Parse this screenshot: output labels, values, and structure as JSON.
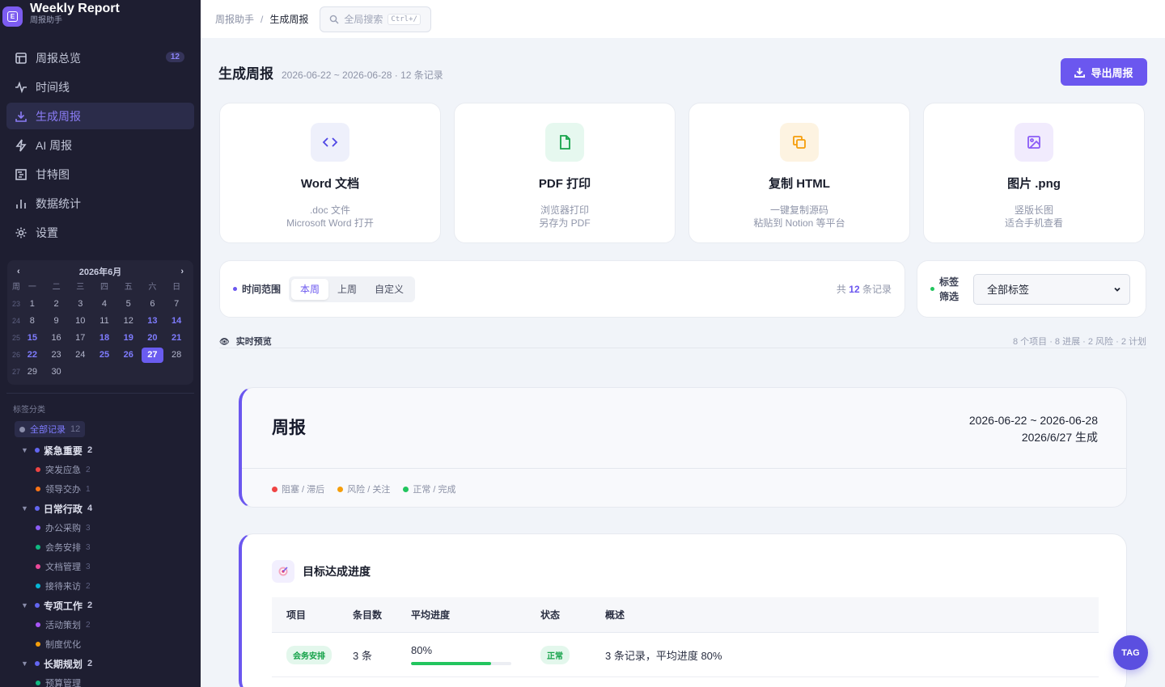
{
  "brand": {
    "title": "Weekly Report",
    "subtitle": "周报助手",
    "logo_letter": "E"
  },
  "nav": {
    "items": [
      {
        "label": "周报总览",
        "icon": "layout-icon",
        "badge": "12"
      },
      {
        "label": "时间线",
        "icon": "activity-icon"
      },
      {
        "label": "生成周报",
        "icon": "download-icon",
        "active": true
      },
      {
        "label": "AI 周报",
        "icon": "zap-icon"
      },
      {
        "label": "甘特图",
        "icon": "gantt-icon"
      },
      {
        "label": "数据统计",
        "icon": "bar-chart-icon"
      },
      {
        "label": "设置",
        "icon": "gear-icon"
      }
    ]
  },
  "calendar": {
    "month": "2026年6月",
    "prev": "‹",
    "next": "›",
    "weekdays": [
      "周",
      "一",
      "二",
      "三",
      "四",
      "五",
      "六",
      "日"
    ],
    "weeks": [
      {
        "wk": "23",
        "days": [
          "1",
          "2",
          "3",
          "4",
          "5",
          "6",
          "7"
        ]
      },
      {
        "wk": "24",
        "days": [
          "8",
          "9",
          "10",
          "11",
          "12",
          "13",
          "14"
        ]
      },
      {
        "wk": "25",
        "days": [
          "15",
          "16",
          "17",
          "18",
          "19",
          "20",
          "21"
        ]
      },
      {
        "wk": "26",
        "days": [
          "22",
          "23",
          "24",
          "25",
          "26",
          "27",
          "28"
        ]
      },
      {
        "wk": "27",
        "days": [
          "29",
          "30",
          "",
          "",
          "",
          "",
          ""
        ]
      }
    ],
    "highlighted": [
      "13",
      "14",
      "15",
      "18",
      "19",
      "20",
      "21",
      "22",
      "25",
      "26"
    ],
    "today": "27"
  },
  "tags": {
    "heading": "标签分类",
    "all": {
      "label": "全部记录",
      "count": "12"
    },
    "groups": [
      {
        "label": "紧急重要",
        "count": "2",
        "color": "#6366f1",
        "children": [
          {
            "label": "突发应急",
            "count": "2",
            "color": "#ef4444"
          },
          {
            "label": "领导交办",
            "count": "1",
            "color": "#f97316"
          }
        ]
      },
      {
        "label": "日常行政",
        "count": "4",
        "color": "#6366f1",
        "children": [
          {
            "label": "办公采购",
            "count": "3",
            "color": "#8b5cf6"
          },
          {
            "label": "会务安排",
            "count": "3",
            "color": "#10b981"
          },
          {
            "label": "文档管理",
            "count": "3",
            "color": "#ec4899"
          },
          {
            "label": "接待来访",
            "count": "2",
            "color": "#06b6d4"
          }
        ]
      },
      {
        "label": "专项工作",
        "count": "2",
        "color": "#6366f1",
        "children": [
          {
            "label": "活动策划",
            "count": "2",
            "color": "#a855f7"
          },
          {
            "label": "制度优化",
            "count": "",
            "color": "#f59e0b"
          }
        ]
      },
      {
        "label": "长期规划",
        "count": "2",
        "color": "#6366f1",
        "children": [
          {
            "label": "预算管理",
            "count": "",
            "color": "#10b981"
          }
        ]
      }
    ]
  },
  "topbar": {
    "breadcrumb": [
      "周报助手",
      "生成周报"
    ],
    "separator": "/",
    "search_placeholder": "全局搜索",
    "search_shortcut": "Ctrl+/"
  },
  "page": {
    "title": "生成周报",
    "subtitle": "2026-06-22 ~ 2026-06-28 · 12 条记录",
    "export_label": "导出周报"
  },
  "export_cards": [
    {
      "title": "Word 文档",
      "line1": ".doc 文件",
      "line2": "Microsoft Word 打开",
      "icon": "code-icon",
      "bg": "#eef0fb",
      "color": "#4f46e5"
    },
    {
      "title": "PDF 打印",
      "line1": "浏览器打印",
      "line2": "另存为 PDF",
      "icon": "file-icon",
      "bg": "#e6f8ef",
      "color": "#16a34a"
    },
    {
      "title": "复制 HTML",
      "line1": "一键复制源码",
      "line2": "粘贴到 Notion 等平台",
      "icon": "copy-icon",
      "bg": "#fdf3e1",
      "color": "#f59e0b"
    },
    {
      "title": "图片 .png",
      "line1": "竖版长图",
      "line2": "适合手机查看",
      "icon": "image-icon",
      "bg": "#f1ebfd",
      "color": "#8b5cf6"
    }
  ],
  "filter": {
    "label": "时间范围",
    "options": [
      "本周",
      "上周",
      "自定义"
    ],
    "selected": "本周",
    "count_prefix": "共",
    "count_value": "12",
    "count_suffix": "条记录"
  },
  "tag_filter": {
    "label": "标签筛选",
    "selected": "全部标签"
  },
  "preview": {
    "label": "实时预览",
    "stats": "8 个项目 · 8 进展 · 2 风险 · 2 计划"
  },
  "weekly": {
    "title": "周报",
    "date_range": "2026-06-22 ~ 2026-06-28",
    "generated": "2026/6/27 生成",
    "legend": [
      {
        "label": "阻塞 / 滞后",
        "color": "#ef4444"
      },
      {
        "label": "风险 / 关注",
        "color": "#f59e0b"
      },
      {
        "label": "正常 / 完成",
        "color": "#22c55e"
      }
    ]
  },
  "goal": {
    "title": "目标达成进度",
    "columns": [
      "项目",
      "条目数",
      "平均进度",
      "状态",
      "概述"
    ],
    "rows": [
      {
        "project": "会务安排",
        "items": "3 条",
        "progress_label": "80%",
        "progress": 0.8,
        "status": "正常",
        "summary": "3 条记录，平均进度 80%"
      }
    ]
  },
  "fab": {
    "label": "TAG"
  }
}
